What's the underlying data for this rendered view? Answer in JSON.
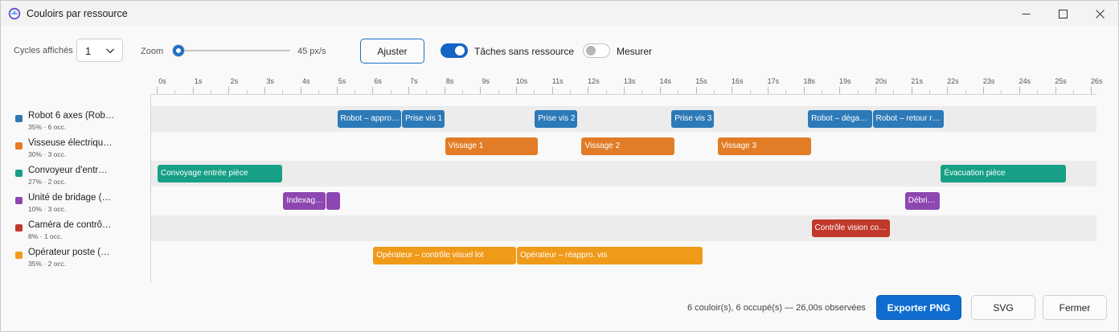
{
  "window": {
    "title": "Couloirs par ressource",
    "controls": [
      "minimize-icon",
      "maximize-icon",
      "close-icon"
    ]
  },
  "toolbar": {
    "cycles_label": "Cycles affichés",
    "cycles_value": "1",
    "zoom_label": "Zoom",
    "zoom_value": "45 px/s",
    "zoom_level_fraction": 0.03,
    "adjust_label": "Ajuster",
    "unassigned_label": "Tâches sans ressource",
    "unassigned_on": true,
    "measure_label": "Mesurer",
    "measure_on": false
  },
  "timeline": {
    "ticks": [
      "0s",
      "1s",
      "2s",
      "3s",
      "4s",
      "5s",
      "6s",
      "7s",
      "8s",
      "9s",
      "10s",
      "11s",
      "12s",
      "13s",
      "14s",
      "15s",
      "16s",
      "17s",
      "18s",
      "19s",
      "20s",
      "21s",
      "22s",
      "23s",
      "24s",
      "25s",
      "26s"
    ],
    "lanes": [
      {
        "name": "Robot 6 axes (Rob…",
        "stats": "35% · 6 occ.",
        "color": "#2d7ab8",
        "tasks": [
          {
            "label": "Robot – appro…",
            "start": 5.0,
            "end": 6.8
          },
          {
            "label": "Prise vis 1",
            "start": 6.8,
            "end": 8.0
          },
          {
            "label": "Prise vis 2",
            "start": 10.5,
            "end": 11.7
          },
          {
            "label": "Prise vis 3",
            "start": 14.3,
            "end": 15.5
          },
          {
            "label": "Robot – déga…",
            "start": 18.1,
            "end": 19.9
          },
          {
            "label": "Robot – retour r…",
            "start": 19.9,
            "end": 21.9
          }
        ]
      },
      {
        "name": "Visseuse électriqu…",
        "stats": "30% · 3 occ.",
        "color": "#e27c26",
        "tasks": [
          {
            "label": "Vissage 1",
            "start": 8.0,
            "end": 10.6
          },
          {
            "label": "Vissage 2",
            "start": 11.8,
            "end": 14.4
          },
          {
            "label": "Vissage 3",
            "start": 15.6,
            "end": 18.2
          }
        ]
      },
      {
        "name": "Convoyeur d'entr…",
        "stats": "27% · 2 occ.",
        "color": "#17a085",
        "tasks": [
          {
            "label": "Convoyage entrée pièce",
            "start": 0.0,
            "end": 3.5
          },
          {
            "label": "Évacuation pièce",
            "start": 21.8,
            "end": 25.3
          }
        ]
      },
      {
        "name": "Unité de bridage (…",
        "stats": "10% · 3 occ.",
        "color": "#8d47b0",
        "tasks": [
          {
            "label": "Indexag…",
            "start": 3.5,
            "end": 4.7
          },
          {
            "label": "",
            "start": 4.7,
            "end": 5.1
          },
          {
            "label": "Débri…",
            "start": 20.8,
            "end": 21.8
          }
        ]
      },
      {
        "name": "Caméra de contrô…",
        "stats": "8% · 1 occ.",
        "color": "#c0392b",
        "tasks": [
          {
            "label": "Contrôle vision co…",
            "start": 18.2,
            "end": 20.4
          }
        ]
      },
      {
        "name": "Opérateur poste (…",
        "stats": "35% · 2 occ.",
        "color": "#f09a1a",
        "tasks": [
          {
            "label": "Opérateur – contrôle visuel lot",
            "start": 6.0,
            "end": 10.0
          },
          {
            "label": "Opérateur – réappro. vis",
            "start": 10.0,
            "end": 15.2
          }
        ]
      }
    ]
  },
  "footer": {
    "status": "6 couloir(s), 6 occupé(s) — 26,00s observées",
    "export_png": "Exporter PNG",
    "svg": "SVG",
    "close": "Fermer"
  }
}
